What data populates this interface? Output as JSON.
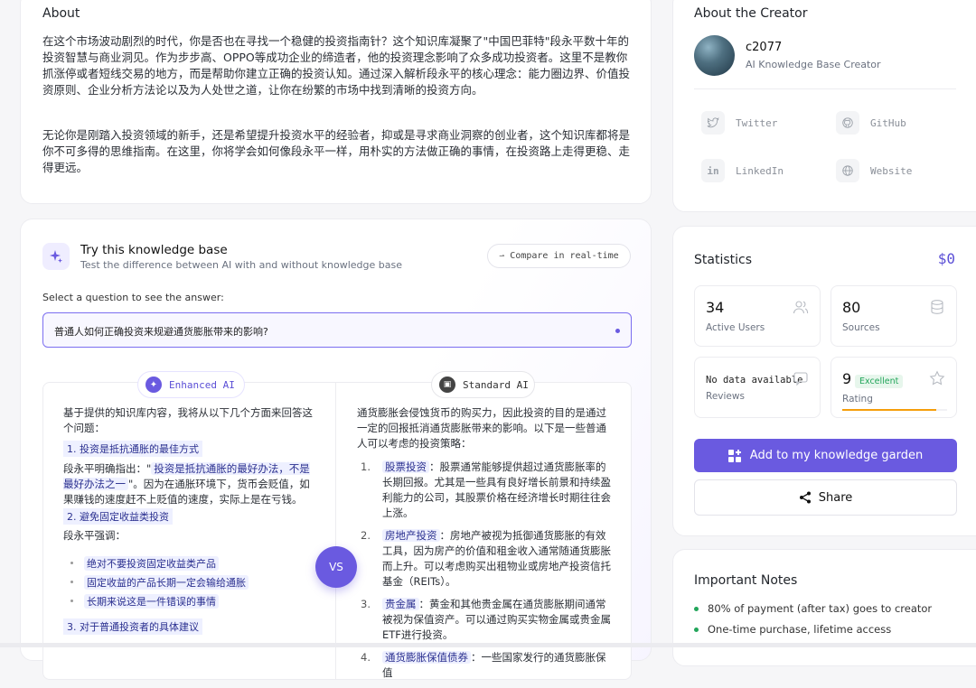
{
  "about": {
    "title": "About",
    "para1": "在这个市场波动剧烈的时代，你是否也在寻找一个稳健的投资指南针？这个知识库凝聚了\"中国巴菲特\"段永平数十年的投资智慧与商业洞见。作为步步高、OPPO等成功企业的缔造者，他的投资理念影响了众多成功投资者。这里不是教你抓涨停或者短线交易的地方，而是帮助你建立正确的投资认知。通过深入解析段永平的核心理念：能力圈边界、价值投资原则、企业分析方法论以及为人处世之道，让你在纷繁的市场中找到清晰的投资方向。",
    "para2": "无论你是刚踏入投资领域的新手，还是希望提升投资水平的经验者，抑或是寻求商业洞察的创业者，这个知识库都将是你不可多得的思维指南。在这里，你将学会如何像段永平一样，用朴实的方法做正确的事情，在投资路上走得更稳、走得更远。"
  },
  "try": {
    "title": "Try this knowledge base",
    "subtitle": "Test the difference between AI with and without knowledge base",
    "compare_label": "Compare in real-time",
    "select_label": "Select a question to see the answer:",
    "question": "普通人如何正确投资来规避通货膨胀带来的影响?",
    "enhanced_label": "Enhanced AI",
    "standard_label": "Standard AI",
    "vs_label": "VS"
  },
  "enhanced": {
    "intro": "基于提供的知识库内容，我将从以下几个方面来回答这个问题：",
    "h1": "1. 投资是抵抗通胀的最佳方式",
    "p1_pre": "段永平明确指出：\"",
    "p1_hl": "投资是抵抗通胀的最好办法，不是最好办法之一",
    "p1_post": "\"。因为在通胀环境下，货币会贬值，如果赚钱的速度赶不上贬值的速度，实际上是在亏钱。",
    "h2": "2. 避免固定收益类投资",
    "p2": "段永平强调：",
    "bullets": [
      "绝对不要投资固定收益类产品",
      "固定收益的产品长期一定会输给通胀",
      "长期来说这是一件错误的事情"
    ],
    "h3": "3. 对于普通投资者的具体建议"
  },
  "standard": {
    "intro": "通货膨胀会侵蚀货币的购买力，因此投资的目的是通过一定的回报抵消通货膨胀带来的影响。以下是一些普通人可以考虑的投资策略：",
    "items": [
      {
        "num": "1.",
        "title": "股票投资",
        "text": "：股票通常能够提供超过通货膨胀率的长期回报。尤其是一些具有良好增长前景和持续盈利能力的公司，其股票价格在经济增长时期往往会上涨。"
      },
      {
        "num": "2.",
        "title": "房地产投资",
        "text": "：房地产被视为抵御通货膨胀的有效工具，因为房产的价值和租金收入通常随通货膨胀而上升。可以考虑购买出租物业或房地产投资信托基金（REITs）。"
      },
      {
        "num": "3.",
        "title": "贵金属",
        "text": "：黄金和其他贵金属在通货膨胀期间通常被视为保值资产。可以通过购买实物金属或贵金属ETF进行投资。"
      },
      {
        "num": "4.",
        "title": "通货膨胀保值债券",
        "text": "：一些国家发行的通货膨胀保值"
      }
    ]
  },
  "creator": {
    "section_title": "About the Creator",
    "name": "c2077",
    "role": "AI Knowledge Base Creator",
    "twitter": "Twitter",
    "github": "GitHub",
    "linkedin": "LinkedIn",
    "website": "Website"
  },
  "stats": {
    "title": "Statistics",
    "price": "$0",
    "users_value": "34",
    "users_label": "Active Users",
    "sources_value": "80",
    "sources_label": "Sources",
    "reviews_value": "No data available",
    "reviews_label": "Reviews",
    "rating_value": "9",
    "rating_badge": "Excellent",
    "rating_label": "Rating",
    "rating_fraction": 0.9,
    "add_button": "Add to my knowledge garden",
    "share_button": "Share"
  },
  "notes": {
    "title": "Important Notes",
    "items": [
      "80% of payment (after tax) goes to creator",
      "One-time purchase, lifetime access"
    ]
  },
  "colors": {
    "accent": "#6a5ae0",
    "success": "#22a55a",
    "rating_bar": "#f59e0b"
  }
}
